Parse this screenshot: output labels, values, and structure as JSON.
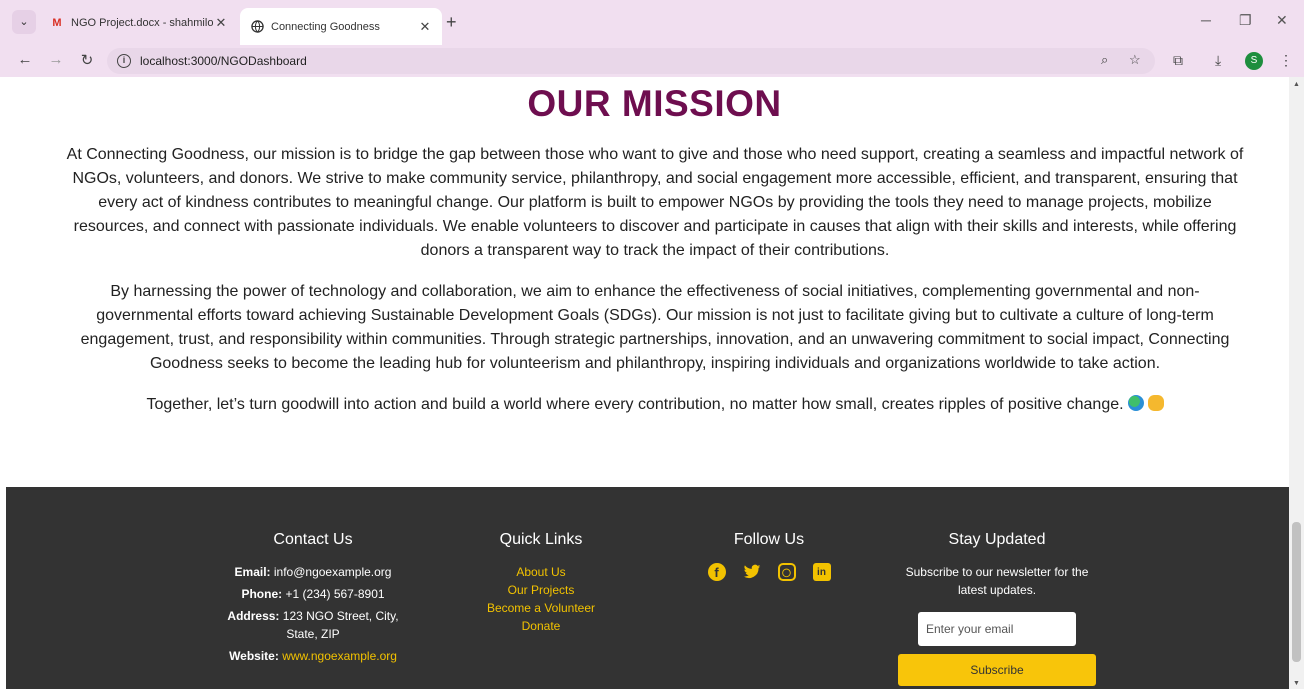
{
  "browser": {
    "tabs": [
      {
        "title": "NGO Project.docx - shahmiloni",
        "favicon": "gmail-icon"
      },
      {
        "title": "Connecting Goodness",
        "favicon": "globe-icon"
      }
    ],
    "url": "localhost:3000/NGODashboard",
    "profile_initial": "S"
  },
  "mission": {
    "title": "OUR MISSION",
    "paragraph1": "At Connecting Goodness, our mission is to bridge the gap between those who want to give and those who need support, creating a seamless and impactful network of NGOs, volunteers, and donors. We strive to make community service, philanthropy, and social engagement more accessible, efficient, and transparent, ensuring that every act of kindness contributes to meaningful change. Our platform is built to empower NGOs by providing the tools they need to manage projects, mobilize resources, and connect with passionate individuals. We enable volunteers to discover and participate in causes that align with their skills and interests, while offering donors a transparent way to track the impact of their contributions.",
    "paragraph2": "By harnessing the power of technology and collaboration, we aim to enhance the effectiveness of social initiatives, complementing governmental and non-governmental efforts toward achieving Sustainable Development Goals (SDGs). Our mission is not just to facilitate giving but to cultivate a culture of long-term engagement, trust, and responsibility within communities. Through strategic partnerships, innovation, and an unwavering commitment to social impact, Connecting Goodness seeks to become the leading hub for volunteerism and philanthropy, inspiring individuals and organizations worldwide to take action.",
    "paragraph3": "Together, let’s turn goodwill into action and build a world where every contribution, no matter how small, creates ripples of positive change."
  },
  "footer": {
    "contact": {
      "heading": "Contact Us",
      "email_label": "Email:",
      "email": "info@ngoexample.org",
      "phone_label": "Phone:",
      "phone": "+1 (234) 567-8901",
      "address_label": "Address:",
      "address": "123 NGO Street, City, State, ZIP",
      "website_label": "Website:",
      "website": "www.ngoexample.org"
    },
    "quick_links": {
      "heading": "Quick Links",
      "items": [
        "About Us",
        "Our Projects",
        "Become a Volunteer",
        "Donate"
      ]
    },
    "follow": {
      "heading": "Follow Us",
      "icons": [
        "facebook-icon",
        "twitter-icon",
        "instagram-icon",
        "linkedin-icon"
      ]
    },
    "stay_updated": {
      "heading": "Stay Updated",
      "text": "Subscribe to our newsletter for the latest updates.",
      "placeholder": "Enter your email",
      "button": "Subscribe"
    }
  },
  "colors": {
    "title": "#6e0e4f",
    "footer_bg": "#333333",
    "accent": "#f8c50a",
    "browser_chrome": "#f1dff0"
  }
}
